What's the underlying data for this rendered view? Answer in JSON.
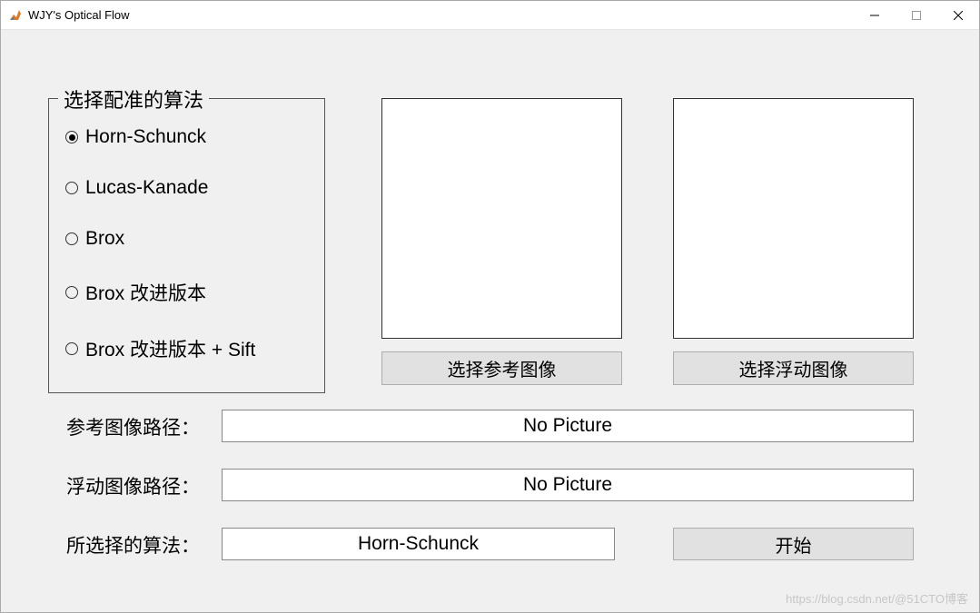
{
  "window": {
    "title": "WJY's Optical Flow"
  },
  "groupbox": {
    "title": "选择配准的算法",
    "options": [
      {
        "label": "Horn-Schunck",
        "checked": true
      },
      {
        "label": "Lucas-Kanade",
        "checked": false
      },
      {
        "label": "Brox",
        "checked": false
      },
      {
        "label": "Brox 改进版本",
        "checked": false
      },
      {
        "label": "Brox 改进版本 + Sift",
        "checked": false
      }
    ]
  },
  "buttons": {
    "select_ref": "选择参考图像",
    "select_float": "选择浮动图像",
    "start": "开始"
  },
  "labels": {
    "ref_path": "参考图像路径：",
    "float_path": "浮动图像路径：",
    "selected_algo": "所选择的算法："
  },
  "values": {
    "ref_path": "No Picture",
    "float_path": "No Picture",
    "selected_algo": "Horn-Schunck"
  },
  "watermark": "https://blog.csdn.net/@51CTO博客"
}
